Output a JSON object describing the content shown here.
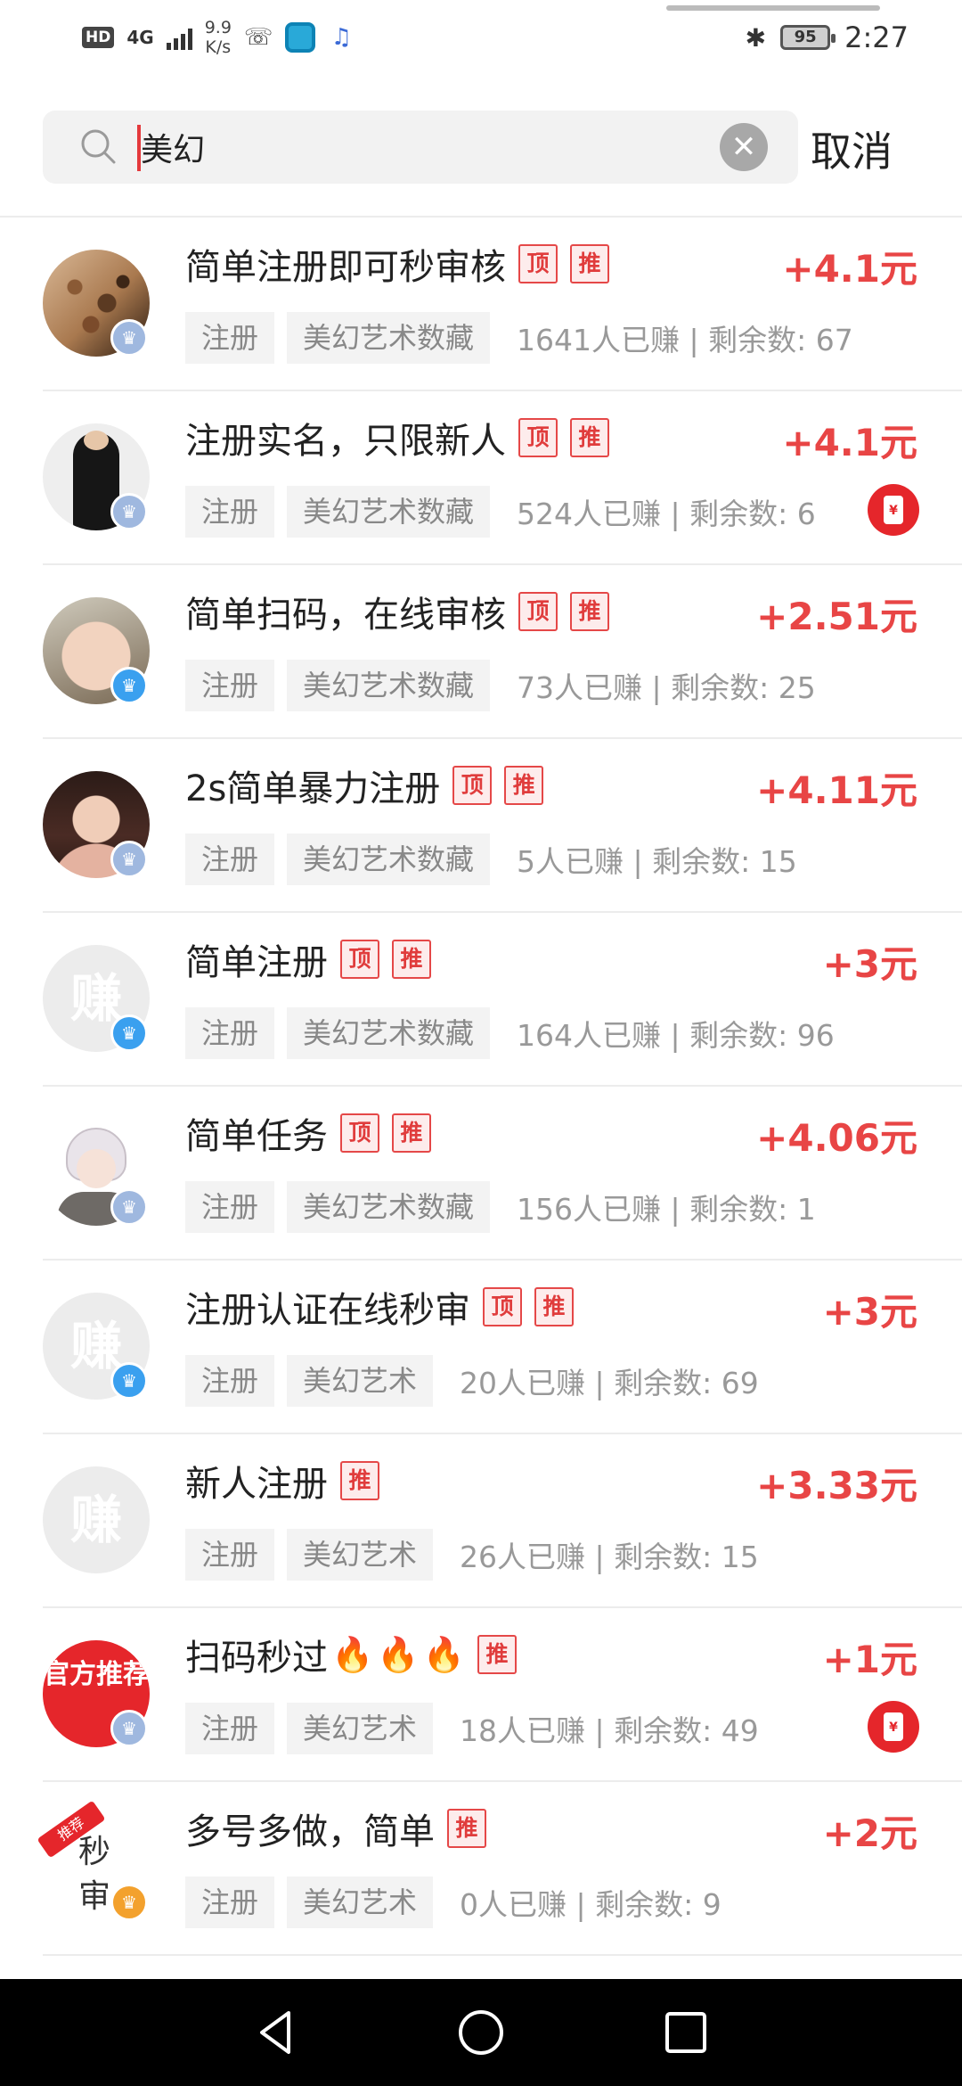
{
  "status_bar": {
    "hd": "HD",
    "signal": "4G",
    "speed_value": "9.9",
    "speed_unit": "K/s",
    "battery": "95",
    "time": "2:27"
  },
  "search": {
    "query": "美幻",
    "cancel_label": "取消"
  },
  "tasks": [
    {
      "title": "简单注册即可秒审核",
      "tags": [
        "顶",
        "推"
      ],
      "reward": "+4.1元",
      "category": "注册",
      "project": "美幻艺术数藏",
      "stats": "1641人已赚 | 剩余数: 67",
      "red_packet": false
    },
    {
      "title": "注册实名，只限新人",
      "tags": [
        "顶",
        "推"
      ],
      "reward": "+4.1元",
      "category": "注册",
      "project": "美幻艺术数藏",
      "stats": "524人已赚 | 剩余数: 6",
      "red_packet": true
    },
    {
      "title": "简单扫码，在线审核",
      "tags": [
        "顶",
        "推"
      ],
      "reward": "+2.51元",
      "category": "注册",
      "project": "美幻艺术数藏",
      "stats": "73人已赚 | 剩余数: 25",
      "red_packet": false
    },
    {
      "title": "2s简单暴力注册",
      "tags": [
        "顶",
        "推"
      ],
      "reward": "+4.11元",
      "category": "注册",
      "project": "美幻艺术数藏",
      "stats": "5人已赚 | 剩余数: 15",
      "red_packet": false
    },
    {
      "title": "简单注册",
      "tags": [
        "顶",
        "推"
      ],
      "reward": "+3元",
      "category": "注册",
      "project": "美幻艺术数藏",
      "stats": "164人已赚 | 剩余数: 96",
      "red_packet": false
    },
    {
      "title": "简单任务",
      "tags": [
        "顶",
        "推"
      ],
      "reward": "+4.06元",
      "category": "注册",
      "project": "美幻艺术数藏",
      "stats": "156人已赚 | 剩余数: 1",
      "red_packet": false
    },
    {
      "title": "注册认证在线秒审",
      "tags": [
        "顶",
        "推"
      ],
      "reward": "+3元",
      "category": "注册",
      "project": "美幻艺术",
      "stats": "20人已赚 | 剩余数: 69",
      "red_packet": false
    },
    {
      "title": "新人注册",
      "tags": [
        "推"
      ],
      "reward": "+3.33元",
      "category": "注册",
      "project": "美幻艺术",
      "stats": "26人已赚 | 剩余数: 15",
      "red_packet": false
    },
    {
      "title": "扫码秒过",
      "tags": [
        "推"
      ],
      "reward": "+1元",
      "category": "注册",
      "project": "美幻艺术",
      "stats": "18人已赚 | 剩余数: 49",
      "red_packet": true
    },
    {
      "title": "多号多做，简单",
      "tags": [
        "推"
      ],
      "reward": "+2元",
      "category": "注册",
      "project": "美幻艺术",
      "stats": "0人已赚 | 剩余数: 9",
      "red_packet": false
    }
  ],
  "avatar_text": {
    "zhuan": "赚",
    "official": "官方推荐",
    "miao_ribbon": "推荐",
    "miao_text": "秒审"
  },
  "colors": {
    "accent_red": "#e84545",
    "tag_red": "#e03c3c",
    "verified_blue": "#3aa0ef"
  }
}
